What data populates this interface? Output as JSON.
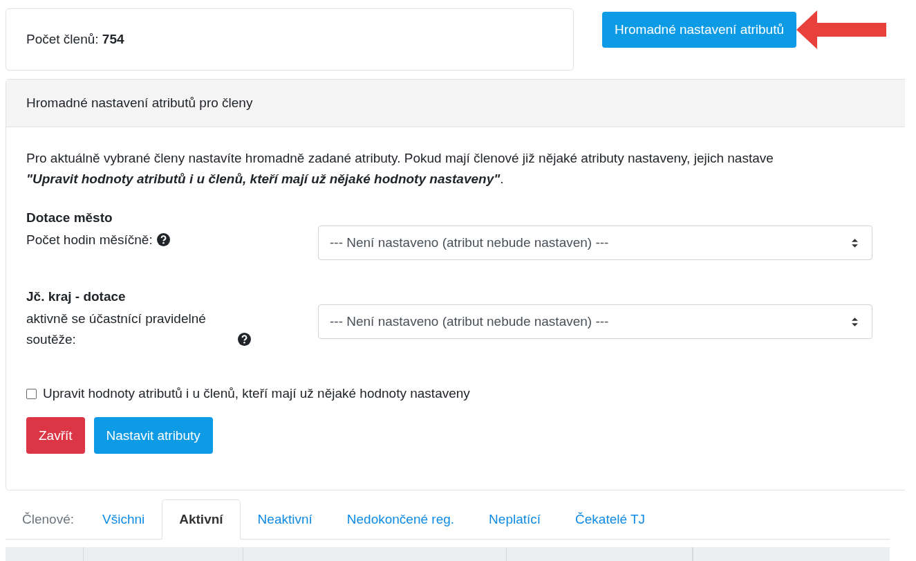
{
  "member_count": {
    "label": "Počet členů:",
    "value": "754"
  },
  "bulk_button": "Hromadné nastavení atributů",
  "panel": {
    "title": "Hromadné nastavení atributů pro členy",
    "intro_line": "Pro aktuálně vybrané členy nastavíte hromadně zadané atributy. Pokud mají členové již nějaké atributy nastaveny, jejich nastave",
    "intro_note": "*\"Upravit hodnoty atributů i u členů, kteří mají už nějaké hodnoty nastaveny\"*.",
    "groups": [
      {
        "heading": "Dotace město",
        "label": "Počet hodin měsíčně:",
        "value": "--- Není nastaveno (atribut nebude nastaven) ---"
      },
      {
        "heading": "Jč. kraj - dotace",
        "label": "aktivně se účastnící pravidelné soutěže:",
        "value": "--- Není nastaveno (atribut nebude nastaven) ---"
      }
    ],
    "checkbox": {
      "label": "Upravit hodnoty atributů i u členů, kteří mají už nějaké hodnoty nastaveny",
      "checked": false
    },
    "buttons": [
      {
        "label": "Zavřít",
        "kind": "danger"
      },
      {
        "label": "Nastavit atributy",
        "kind": "primary"
      }
    ]
  },
  "tabs_label": "Členové:",
  "tabs": [
    {
      "label": "Všichni",
      "selected": false
    },
    {
      "label": "Aktivní",
      "selected": true
    },
    {
      "label": "Neaktivní",
      "selected": false
    },
    {
      "label": "Nedokončené reg.",
      "selected": false
    },
    {
      "label": "Neplatící",
      "selected": false
    },
    {
      "label": "Čekatelé TJ",
      "selected": false
    }
  ]
}
